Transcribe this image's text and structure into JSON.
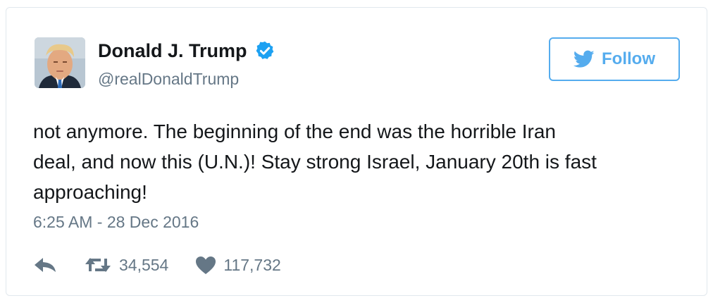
{
  "tweet": {
    "author": {
      "name": "Donald J. Trump",
      "handle": "@realDonaldTrump",
      "verified": true,
      "avatar_icon": "profile-photo"
    },
    "follow_button": {
      "label": "Follow",
      "icon": "twitter-bird-icon"
    },
    "text": "not anymore. The beginning of the end was the horrible Iran\ndeal, and now this (U.N.)! Stay strong Israel, January 20th is fast\napproaching!",
    "timestamp": "6:25 AM - 28 Dec 2016",
    "actions": {
      "reply_icon": "reply-icon",
      "retweet_count": "34,554",
      "like_count": "117,732"
    }
  },
  "colors": {
    "twitter_blue": "#55acee",
    "verified_blue": "#1da1f2",
    "text": "#14171a",
    "secondary_text": "#657786",
    "border": "#e1e8ed"
  }
}
